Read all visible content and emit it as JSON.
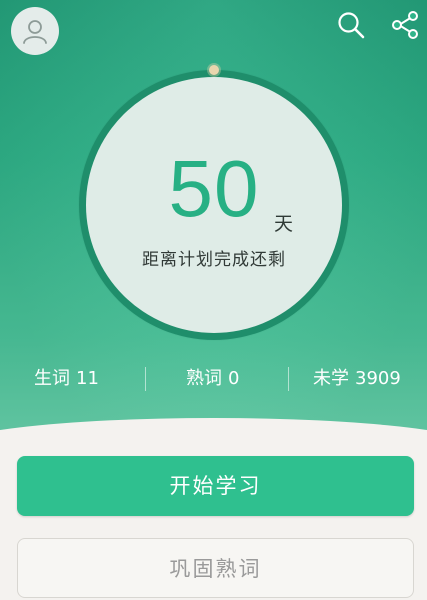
{
  "header": {
    "avatar_icon": "user-avatar-icon",
    "search_icon": "search-icon",
    "share_icon": "share-icon"
  },
  "countdown": {
    "value": "50",
    "unit": "天",
    "caption": "距离计划完成还剩"
  },
  "stats": {
    "new_words": {
      "label": "生词",
      "value": "11"
    },
    "familiar_words": {
      "label": "熟词",
      "value": "0"
    },
    "unlearned": {
      "label": "未学",
      "value": "3909"
    }
  },
  "actions": {
    "start_label": "开始学习",
    "review_label": "巩固熟词"
  },
  "colors": {
    "accent": "#2fc08f",
    "hero_top": "#23a27c",
    "hero_bottom": "#6dd6b0",
    "number": "#27b084"
  }
}
